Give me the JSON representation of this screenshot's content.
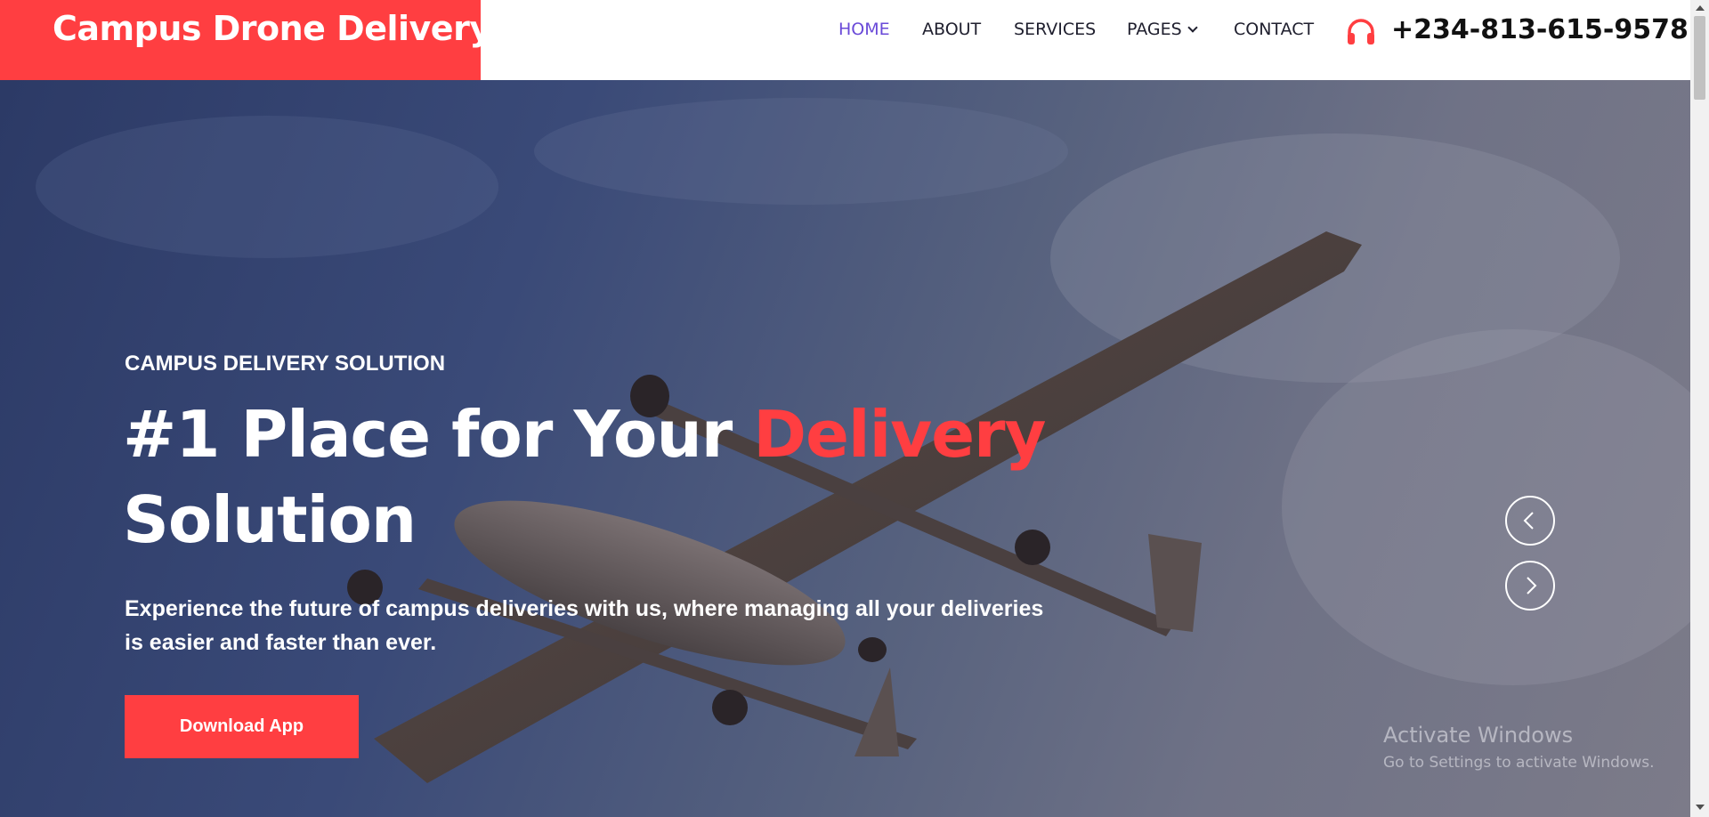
{
  "header": {
    "brand": "Campus Drone Delivery",
    "nav": [
      {
        "label": "HOME",
        "active": true
      },
      {
        "label": "ABOUT",
        "active": false
      },
      {
        "label": "SERVICES",
        "active": false
      },
      {
        "label": "PAGES",
        "active": false,
        "has_dropdown": true
      },
      {
        "label": "CONTACT",
        "active": false
      }
    ],
    "phone": "+234-813-615-9578",
    "phone_icon": "headphones-icon"
  },
  "hero": {
    "eyebrow": "CAMPUS DELIVERY SOLUTION",
    "title_prefix": "#1 Place for Your ",
    "title_accent": "Delivery",
    "title_suffix": "Solution",
    "description": "Experience the future of campus deliveries with us, where managing all your deliveries is easier and faster than ever.",
    "button": "Download App",
    "prev_icon": "chevron-left-icon",
    "next_icon": "chevron-right-icon"
  },
  "watermark": {
    "title": "Activate Windows",
    "subtitle": "Go to Settings to activate Windows."
  },
  "colors": {
    "accent": "#ff3e41",
    "nav_active": "#6a4ad8",
    "nav_text": "#1f1f2e"
  }
}
